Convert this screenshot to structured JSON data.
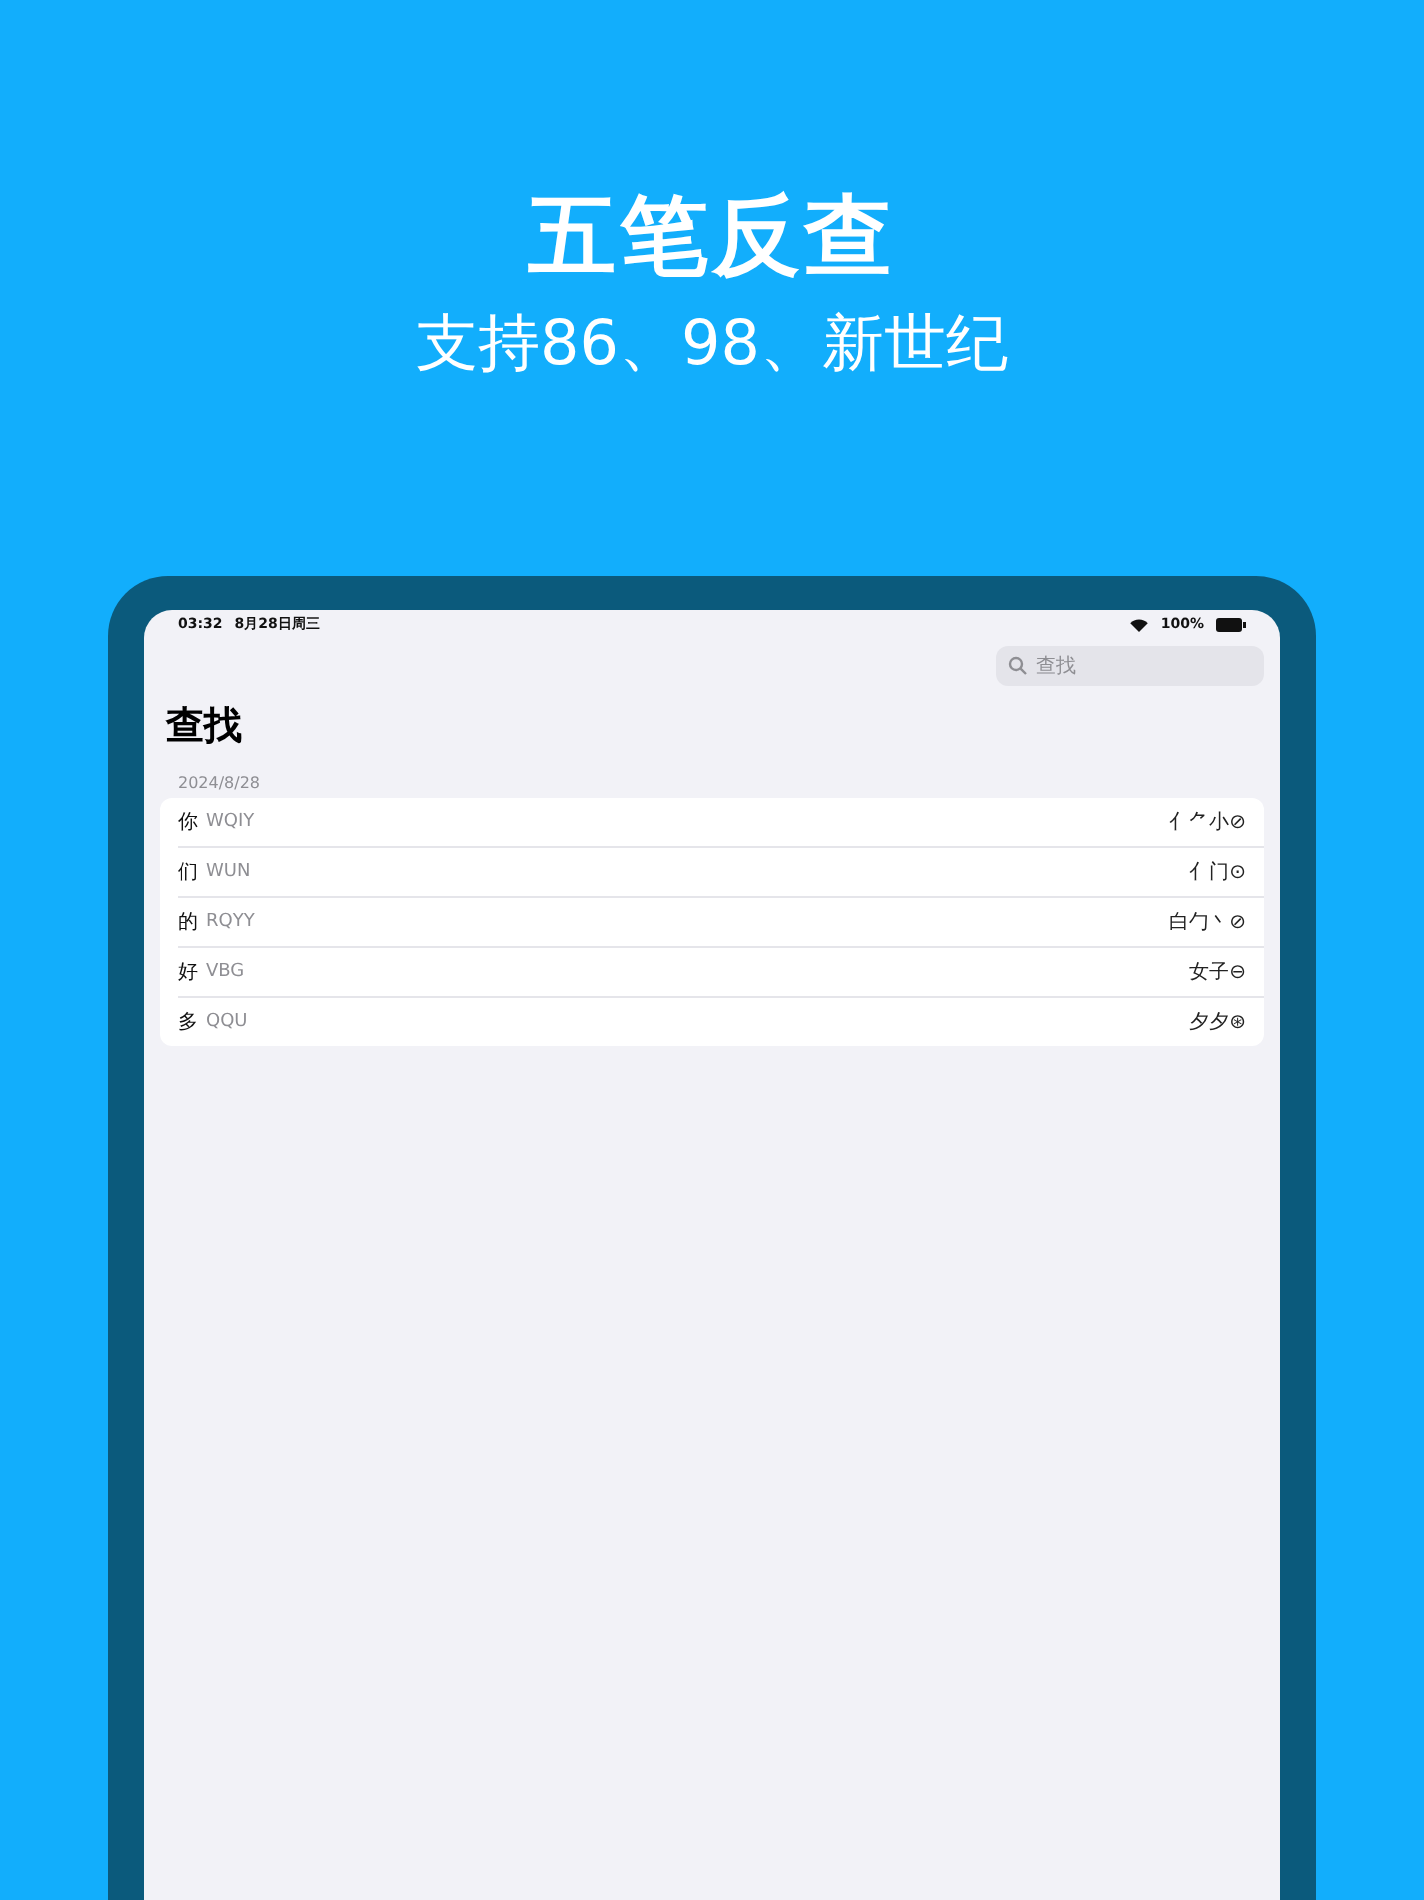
{
  "headline": {
    "title": "五笔反查",
    "subtitle": "支持86、98、新世纪"
  },
  "status_bar": {
    "time": "03:32",
    "date": "8月28日周三",
    "battery": "100%"
  },
  "search": {
    "placeholder": "查找"
  },
  "title": "查找",
  "section": {
    "header": "2024/8/28",
    "rows": [
      {
        "char": "你",
        "code": "WQIY",
        "roots": "亻⺈小⊘"
      },
      {
        "char": "们",
        "code": "WUN",
        "roots": "亻门⊙"
      },
      {
        "char": "的",
        "code": "RQYY",
        "roots": "白勹丶⊘"
      },
      {
        "char": "好",
        "code": "VBG",
        "roots": "女子⊖"
      },
      {
        "char": "多",
        "code": "QQU",
        "roots": "夕夕⊛"
      }
    ]
  }
}
